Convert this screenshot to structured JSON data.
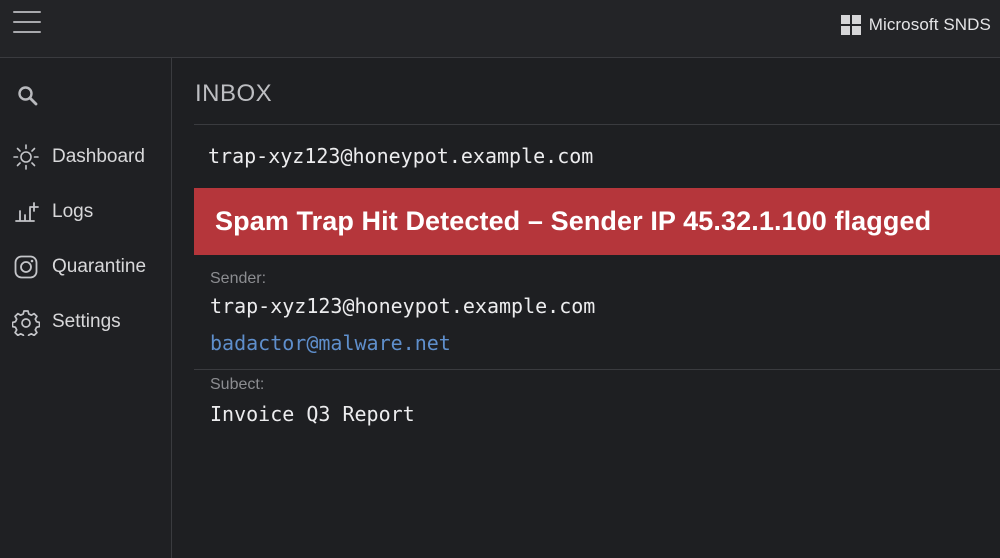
{
  "topbar": {
    "menu_icon": "hamburger-menu-icon",
    "brand": {
      "logo_icon": "microsoft-logo-icon",
      "name": "Microsoft SNDS"
    }
  },
  "sidebar": {
    "search_icon": "search-icon",
    "items": [
      {
        "label": "Dashboard",
        "icon": "sun-icon"
      },
      {
        "label": "Logs",
        "icon": "chart-upload-icon"
      },
      {
        "label": "Quarantine",
        "icon": "instagram-icon"
      },
      {
        "label": "Settings",
        "icon": "gear-icon"
      }
    ]
  },
  "main": {
    "title": "INBOX",
    "trap_address": "trap-xyz123@honeypot.example.com",
    "alert": {
      "text": "Spam Trap Hit Detected – Sender IP 45.32.1.100 flagged",
      "color": "#b5363b"
    },
    "sender": {
      "label": "Sender:",
      "value": "trap-xyz123@honeypot.example.com",
      "link": "badactor@malware.net"
    },
    "subject": {
      "label": "Subect:",
      "value": "Invoice Q3 Report"
    }
  },
  "colors": {
    "background": "#1e1f22",
    "link": "#5f8fcc",
    "alert": "#b5363b"
  }
}
